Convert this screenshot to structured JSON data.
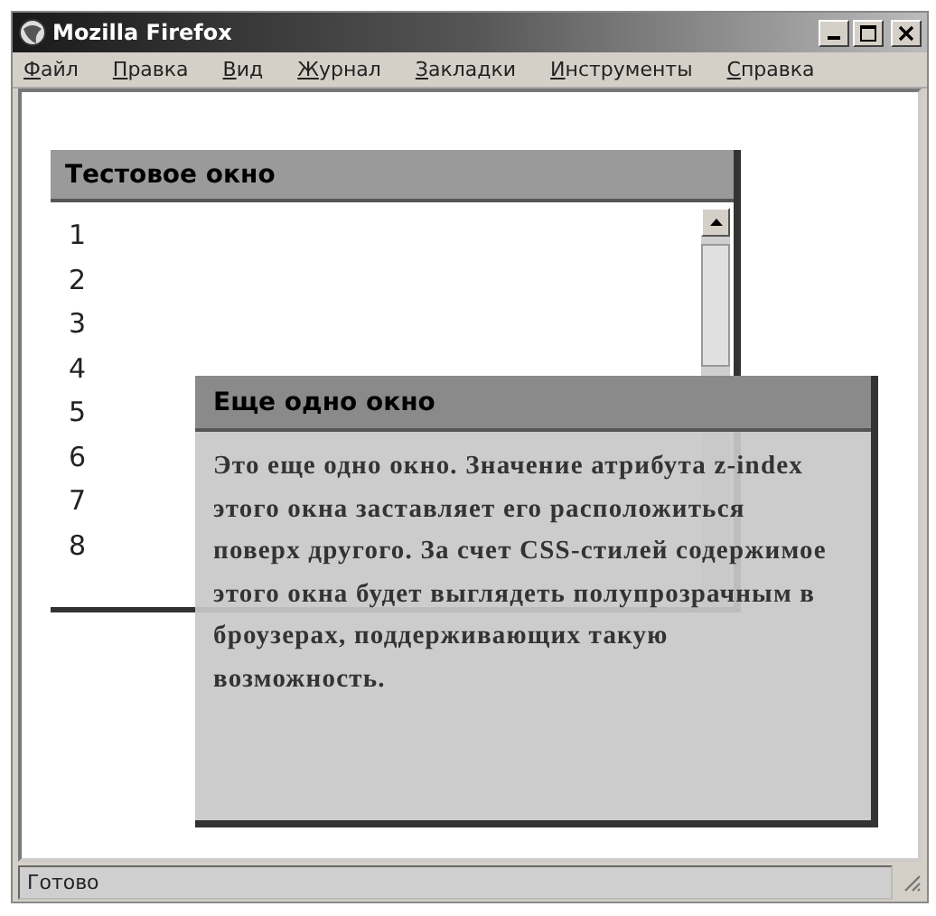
{
  "window": {
    "title": "Mozilla Firefox"
  },
  "menu": [
    "Файл",
    "Правка",
    "Вид",
    "Журнал",
    "Закладки",
    "Инструменты",
    "Справка"
  ],
  "test_window": {
    "title": "Тестовое окно",
    "lines": [
      "1",
      "2",
      "3",
      "4",
      "5",
      "6",
      "7",
      "8"
    ]
  },
  "overlay_window": {
    "title": "Еще одно окно",
    "text": "Это еще одно окно. Значение атрибута z-index этого окна заставляет его расположиться поверх другого. За счет CSS-стилей содержимое этого окна будет выглядеть полупрозрачным в броузерах, поддерживающих такую возможность."
  },
  "status_bar": "Готово"
}
